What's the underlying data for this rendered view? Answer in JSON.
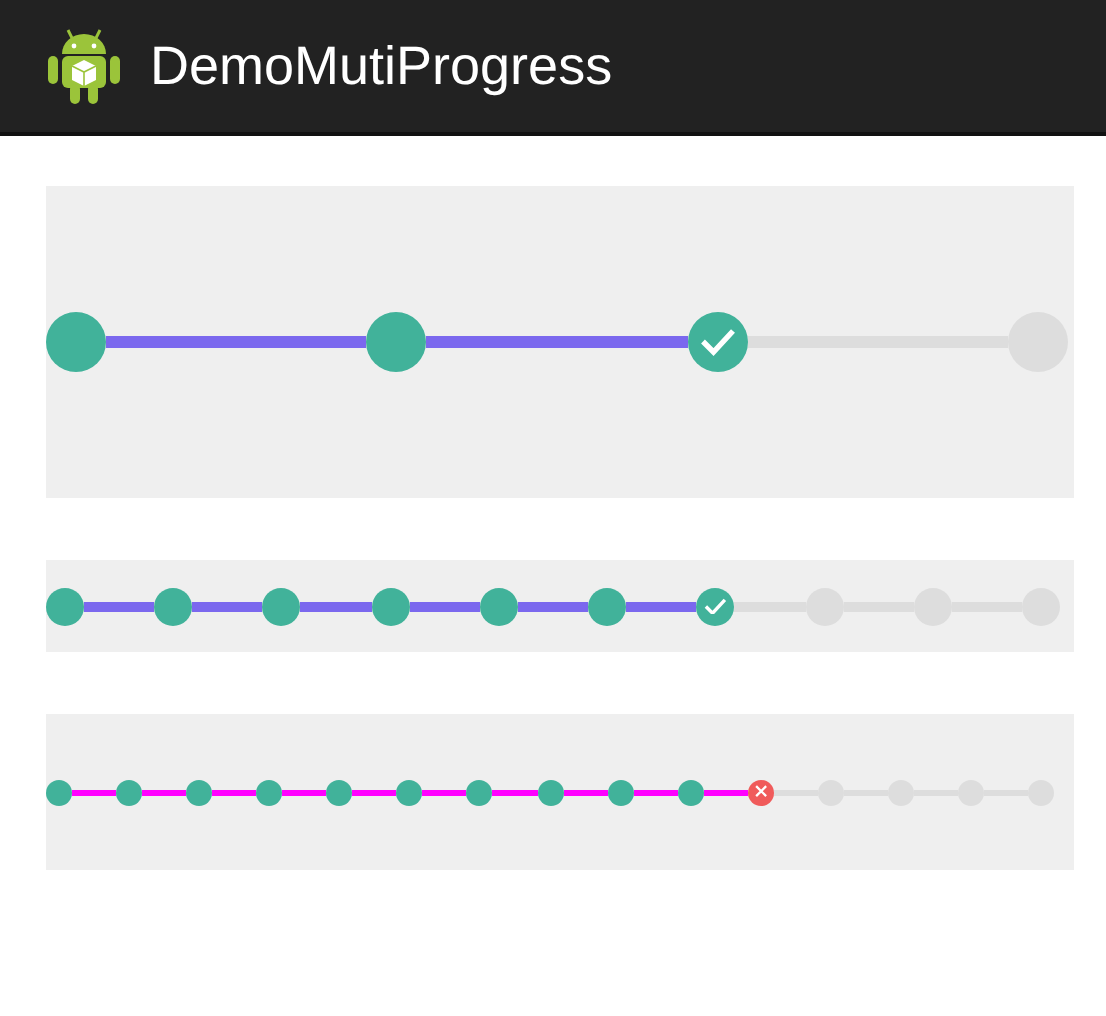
{
  "app_bar": {
    "title": "DemoMutiProgress"
  },
  "progress_bars": [
    {
      "kind": "large",
      "color": "#7b68ee",
      "steps": [
        {
          "kind": "done"
        },
        {
          "kind": "done"
        },
        {
          "kind": "check"
        },
        {
          "kind": "todo"
        }
      ]
    },
    {
      "kind": "medium",
      "color": "#7b68ee",
      "steps": [
        {
          "kind": "done"
        },
        {
          "kind": "done"
        },
        {
          "kind": "done"
        },
        {
          "kind": "done"
        },
        {
          "kind": "done"
        },
        {
          "kind": "done"
        },
        {
          "kind": "check"
        },
        {
          "kind": "todo"
        },
        {
          "kind": "todo"
        },
        {
          "kind": "todo"
        }
      ]
    },
    {
      "kind": "small",
      "color": "#ff00ff",
      "steps": [
        {
          "kind": "done"
        },
        {
          "kind": "done"
        },
        {
          "kind": "done"
        },
        {
          "kind": "done"
        },
        {
          "kind": "done"
        },
        {
          "kind": "done"
        },
        {
          "kind": "done"
        },
        {
          "kind": "done"
        },
        {
          "kind": "done"
        },
        {
          "kind": "done"
        },
        {
          "kind": "error"
        },
        {
          "kind": "todo"
        },
        {
          "kind": "todo"
        },
        {
          "kind": "todo"
        },
        {
          "kind": "todo"
        }
      ]
    }
  ]
}
